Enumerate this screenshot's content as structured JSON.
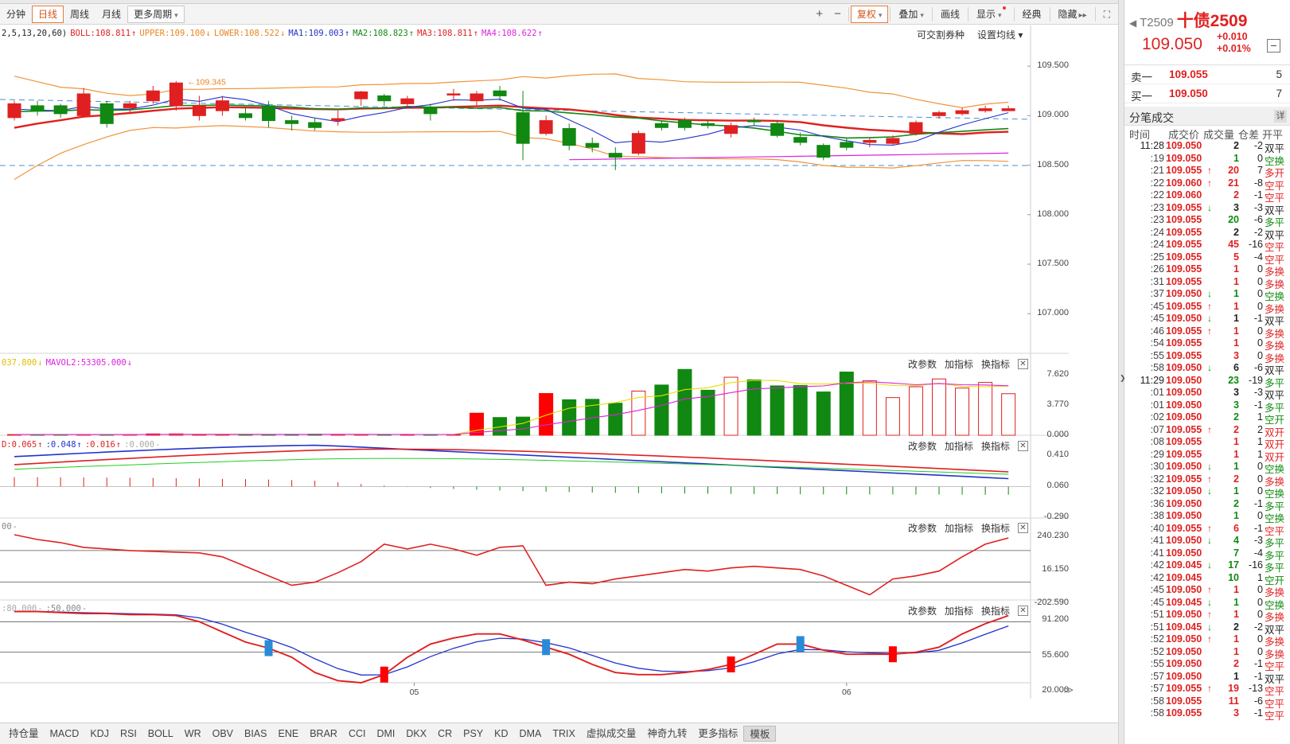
{
  "toolbar": {
    "left": [
      "分钟",
      "日线",
      "周线",
      "月线",
      "更多周期"
    ],
    "active": "日线",
    "right_icons": [
      "+",
      "−"
    ],
    "right": [
      "复权",
      "叠加",
      "画线",
      "显示",
      "经典",
      "隐藏"
    ]
  },
  "legend_main": {
    "params": "2,5,13,20,60)",
    "items": [
      {
        "text": "BOLL:108.811",
        "color": "#e02020",
        "arrow": "↑"
      },
      {
        "text": "UPPER:109.100",
        "color": "#e8851f",
        "arrow": "↓"
      },
      {
        "text": "LOWER:108.522",
        "color": "#e8851f",
        "arrow": "↓"
      },
      {
        "text": "MA1:109.003",
        "color": "#2233cc",
        "arrow": "↑"
      },
      {
        "text": "MA2:108.823",
        "color": "#118811",
        "arrow": "↑"
      },
      {
        "text": "MA3:108.811",
        "color": "#e02020",
        "arrow": "↑"
      },
      {
        "text": "MA4:108.622",
        "color": "#dd22dd",
        "arrow": "↑"
      }
    ],
    "right1": "可交割券种",
    "right2": "设置均线"
  },
  "legend_vol": {
    "items": [
      {
        "text": "037.800",
        "color": "#e0c000",
        "arrow": "↓"
      },
      {
        "text": "MAVOL2:53305.000",
        "color": "#dd22dd",
        "arrow": "↓"
      }
    ]
  },
  "legend_macd": {
    "items": [
      {
        "text": "D:0.065",
        "color": "#e02020",
        "arrow": "↑"
      },
      {
        "text": ":0.048",
        "color": "#2233cc",
        "arrow": "↑"
      },
      {
        "text": ":0.016",
        "color": "#e02020",
        "arrow": "↑"
      },
      {
        "text": ":0.000",
        "color": "#aaaaaa",
        "arrow": "-"
      }
    ]
  },
  "legend_cci": {
    "items": [
      {
        "text": "00",
        "color": "#888888",
        "arrow": "-"
      }
    ]
  },
  "legend_kd": {
    "items": [
      {
        "text": ":80.000",
        "color": "#aaaaaa",
        "arrow": "-"
      },
      {
        "text": ":50.000",
        "color": "#888888",
        "arrow": "-"
      }
    ]
  },
  "panel_controls": [
    "改参数",
    "加指标",
    "换指标"
  ],
  "y_labels": {
    "main": [
      "109.500",
      "109.000",
      "108.500",
      "108.000",
      "107.500",
      "107.000"
    ],
    "vol": [
      "7.620",
      "3.770",
      "0.000"
    ],
    "macd": [
      "0.410",
      "0.060",
      "-0.290"
    ],
    "cci": [
      "240.230",
      "16.150",
      "-202.590"
    ],
    "kd": [
      "91.200",
      "55.600",
      "20.000"
    ]
  },
  "x_labels": [
    "05",
    "06"
  ],
  "hi_label": "109.345",
  "bottom_tabs": [
    "持仓量",
    "MACD",
    "KDJ",
    "RSI",
    "BOLL",
    "WR",
    "OBV",
    "BIAS",
    "ENE",
    "BRAR",
    "CCI",
    "DMI",
    "DKX",
    "CR",
    "PSY",
    "KD",
    "DMA",
    "TRIX",
    "虚拟成交量",
    "神奇九转",
    "更多指标",
    "模板"
  ],
  "bottom_active": "模板",
  "sidepanel": {
    "code": "T2509",
    "name": "十债2509",
    "price": "109.050",
    "chg": "+0.010",
    "chg_pct": "+0.01%",
    "sell_label": "卖一",
    "sell_price": "109.055",
    "sell_vol": "5",
    "buy_label": "买一",
    "buy_price": "109.050",
    "buy_vol": "7",
    "section": "分笔成交",
    "detail": "详",
    "cols": [
      "时间",
      "成交价",
      "成交量",
      "仓差",
      "开平"
    ]
  },
  "ticks": [
    [
      "11:28",
      "109.050",
      "",
      "2",
      "-2",
      "双平",
      "black"
    ],
    [
      ":19",
      "109.050",
      "",
      "1",
      "0",
      "空换",
      "green"
    ],
    [
      ":21",
      "109.055",
      "up",
      "20",
      "7",
      "多开",
      "red"
    ],
    [
      ":22",
      "109.060",
      "up",
      "21",
      "-8",
      "空平",
      "red"
    ],
    [
      ":22",
      "109.060",
      "",
      "2",
      "-1",
      "空平",
      "red"
    ],
    [
      ":23",
      "109.055",
      "down",
      "3",
      "-3",
      "双平",
      "black"
    ],
    [
      ":23",
      "109.055",
      "",
      "20",
      "-6",
      "多平",
      "green"
    ],
    [
      ":24",
      "109.055",
      "",
      "2",
      "-2",
      "双平",
      "black"
    ],
    [
      ":24",
      "109.055",
      "",
      "45",
      "-16",
      "空平",
      "red"
    ],
    [
      ":25",
      "109.055",
      "",
      "5",
      "-4",
      "空平",
      "red"
    ],
    [
      ":26",
      "109.055",
      "",
      "1",
      "0",
      "多换",
      "red"
    ],
    [
      ":31",
      "109.055",
      "",
      "1",
      "0",
      "多换",
      "red"
    ],
    [
      ":37",
      "109.050",
      "down",
      "1",
      "0",
      "空换",
      "green"
    ],
    [
      ":45",
      "109.055",
      "up",
      "1",
      "0",
      "多换",
      "red"
    ],
    [
      ":45",
      "109.050",
      "down",
      "1",
      "-1",
      "双平",
      "black"
    ],
    [
      ":46",
      "109.055",
      "up",
      "1",
      "0",
      "多换",
      "red"
    ],
    [
      ":54",
      "109.055",
      "",
      "1",
      "0",
      "多换",
      "red"
    ],
    [
      ":55",
      "109.055",
      "",
      "3",
      "0",
      "多换",
      "red"
    ],
    [
      ":58",
      "109.050",
      "down",
      "6",
      "-6",
      "双平",
      "black"
    ],
    [
      "11:29",
      "109.050",
      "",
      "23",
      "-19",
      "多平",
      "green"
    ],
    [
      ":01",
      "109.050",
      "",
      "3",
      "-3",
      "双平",
      "black"
    ],
    [
      ":01",
      "109.050",
      "",
      "3",
      "-1",
      "多平",
      "green"
    ],
    [
      ":02",
      "109.050",
      "",
      "2",
      "1",
      "空开",
      "green"
    ],
    [
      ":07",
      "109.055",
      "up",
      "2",
      "2",
      "双开",
      "red"
    ],
    [
      ":08",
      "109.055",
      "",
      "1",
      "1",
      "双开",
      "red"
    ],
    [
      ":29",
      "109.055",
      "",
      "1",
      "1",
      "双开",
      "red"
    ],
    [
      ":30",
      "109.050",
      "down",
      "1",
      "0",
      "空换",
      "green"
    ],
    [
      ":32",
      "109.055",
      "up",
      "2",
      "0",
      "多换",
      "red"
    ],
    [
      ":32",
      "109.050",
      "down",
      "1",
      "0",
      "空换",
      "green"
    ],
    [
      ":36",
      "109.050",
      "",
      "2",
      "-1",
      "多平",
      "green"
    ],
    [
      ":38",
      "109.050",
      "",
      "1",
      "0",
      "空换",
      "green"
    ],
    [
      ":40",
      "109.055",
      "up",
      "6",
      "-1",
      "空平",
      "red"
    ],
    [
      ":41",
      "109.050",
      "down",
      "4",
      "-3",
      "多平",
      "green"
    ],
    [
      ":41",
      "109.050",
      "",
      "7",
      "-4",
      "多平",
      "green"
    ],
    [
      ":42",
      "109.045",
      "down",
      "17",
      "-16",
      "多平",
      "green"
    ],
    [
      ":42",
      "109.045",
      "",
      "10",
      "1",
      "空开",
      "green"
    ],
    [
      ":45",
      "109.050",
      "up",
      "1",
      "0",
      "多换",
      "red"
    ],
    [
      ":45",
      "109.045",
      "down",
      "1",
      "0",
      "空换",
      "green"
    ],
    [
      ":51",
      "109.050",
      "up",
      "1",
      "0",
      "多换",
      "red"
    ],
    [
      ":51",
      "109.045",
      "down",
      "2",
      "-2",
      "双平",
      "black"
    ],
    [
      ":52",
      "109.050",
      "up",
      "1",
      "0",
      "多换",
      "red"
    ],
    [
      ":52",
      "109.050",
      "",
      "1",
      "0",
      "多换",
      "red"
    ],
    [
      ":55",
      "109.050",
      "",
      "2",
      "-1",
      "空平",
      "red"
    ],
    [
      ":57",
      "109.050",
      "",
      "1",
      "-1",
      "双平",
      "black"
    ],
    [
      ":57",
      "109.055",
      "up",
      "19",
      "-13",
      "空平",
      "red"
    ],
    [
      ":58",
      "109.055",
      "",
      "11",
      "-6",
      "空平",
      "red"
    ],
    [
      ":58",
      "109.055",
      "",
      "3",
      "-1",
      "空平",
      "red"
    ]
  ],
  "colors": {
    "up": "#e02020",
    "down": "#118811",
    "ma1": "#2233cc",
    "ma2": "#118811",
    "boll": "#e02020",
    "band": "#f0943a",
    "ma4": "#dd22dd",
    "vol_ma1": "#e8e000"
  },
  "chart_data": {
    "type": "candlestick",
    "x_ticks": [
      "05",
      "06"
    ],
    "ylim": [
      106.6,
      109.75
    ],
    "candles": [
      [
        108.98,
        109.12,
        109.15,
        108.95
      ],
      [
        109.1,
        109.05,
        109.15,
        109.0
      ],
      [
        109.1,
        109.02,
        109.12,
        108.98
      ],
      [
        109.0,
        109.22,
        109.28,
        108.98
      ],
      [
        109.12,
        108.92,
        109.15,
        108.88
      ],
      [
        109.08,
        109.12,
        109.15,
        109.03
      ],
      [
        109.15,
        109.25,
        109.3,
        109.12
      ],
      [
        109.1,
        109.33,
        109.35,
        109.05
      ],
      [
        109.0,
        109.1,
        109.2,
        108.95
      ],
      [
        109.05,
        109.15,
        109.2,
        109.0
      ],
      [
        109.02,
        108.98,
        109.08,
        108.95
      ],
      [
        109.1,
        108.95,
        109.15,
        108.88
      ],
      [
        108.95,
        108.92,
        109.0,
        108.85
      ],
      [
        108.93,
        108.88,
        108.98,
        108.85
      ],
      [
        108.95,
        108.97,
        109.05,
        108.9
      ],
      [
        109.17,
        109.24,
        109.25,
        109.1
      ],
      [
        109.2,
        109.15,
        109.22,
        109.1
      ],
      [
        109.12,
        109.17,
        109.2,
        109.08
      ],
      [
        109.08,
        109.02,
        109.12,
        108.95
      ],
      [
        109.22,
        109.22,
        109.27,
        109.15
      ],
      [
        109.15,
        109.22,
        109.25,
        109.1
      ],
      [
        109.25,
        109.2,
        109.3,
        109.15
      ],
      [
        109.03,
        108.72,
        109.25,
        108.55
      ],
      [
        108.82,
        108.95,
        109.0,
        108.8
      ],
      [
        108.87,
        108.7,
        108.92,
        108.65
      ],
      [
        108.72,
        108.68,
        108.78,
        108.63
      ],
      [
        108.62,
        108.58,
        108.68,
        108.45
      ],
      [
        108.62,
        108.82,
        108.85,
        108.6
      ],
      [
        108.92,
        108.88,
        108.95,
        108.85
      ],
      [
        108.95,
        108.88,
        108.98,
        108.85
      ],
      [
        108.92,
        108.9,
        108.95,
        108.87
      ],
      [
        108.82,
        108.9,
        108.93,
        108.78
      ],
      [
        108.95,
        108.94,
        108.98,
        108.9
      ],
      [
        108.92,
        108.8,
        108.95,
        108.78
      ],
      [
        108.78,
        108.73,
        108.83,
        108.7
      ],
      [
        108.7,
        108.58,
        108.72,
        108.55
      ],
      [
        108.73,
        108.68,
        108.78,
        108.65
      ],
      [
        108.73,
        108.75,
        108.78,
        108.68
      ],
      [
        108.72,
        108.77,
        108.8,
        108.7
      ],
      [
        108.82,
        108.93,
        108.95,
        108.8
      ],
      [
        109.0,
        109.03,
        109.05,
        108.97
      ],
      [
        109.02,
        109.05,
        109.08,
        109.0
      ],
      [
        109.05,
        109.07,
        109.1,
        109.03
      ],
      [
        109.05,
        109.07,
        109.1,
        109.05
      ]
    ],
    "volume": [
      0.08,
      0.08,
      0.08,
      0.08,
      0.08,
      0.08,
      0.16,
      0.17,
      0.1,
      0.08,
      0.08,
      0.08,
      0.1,
      0.12,
      0.1,
      0.08,
      0.08,
      0.1,
      0.08,
      0.06,
      2.55,
      2.05,
      2.1,
      4.82,
      4.1,
      4.15,
      3.7,
      5.1,
      5.8,
      7.6,
      5.2,
      6.7,
      6.4,
      5.7,
      5.75,
      5.0,
      7.3,
      6.3,
      4.35,
      5.6,
      6.5,
      5.45,
      6.1,
      4.8,
      4.8,
      2.5
    ],
    "volume_up": [
      0,
      0,
      0,
      0,
      0,
      0,
      1,
      0,
      1,
      1,
      0,
      1,
      0,
      0,
      1,
      1,
      0,
      0,
      0,
      1,
      0,
      1,
      1,
      1,
      1,
      0,
      1,
      0,
      1,
      1,
      1,
      1,
      0,
      0,
      1,
      1,
      0,
      1,
      0,
      1,
      1,
      0,
      1,
      0,
      1,
      1
    ],
    "macd_ylim": [
      -0.29,
      0.41
    ],
    "cci_ylim": [
      -202.59,
      240.23
    ],
    "kd_ylim": [
      20.0,
      91.2
    ]
  }
}
